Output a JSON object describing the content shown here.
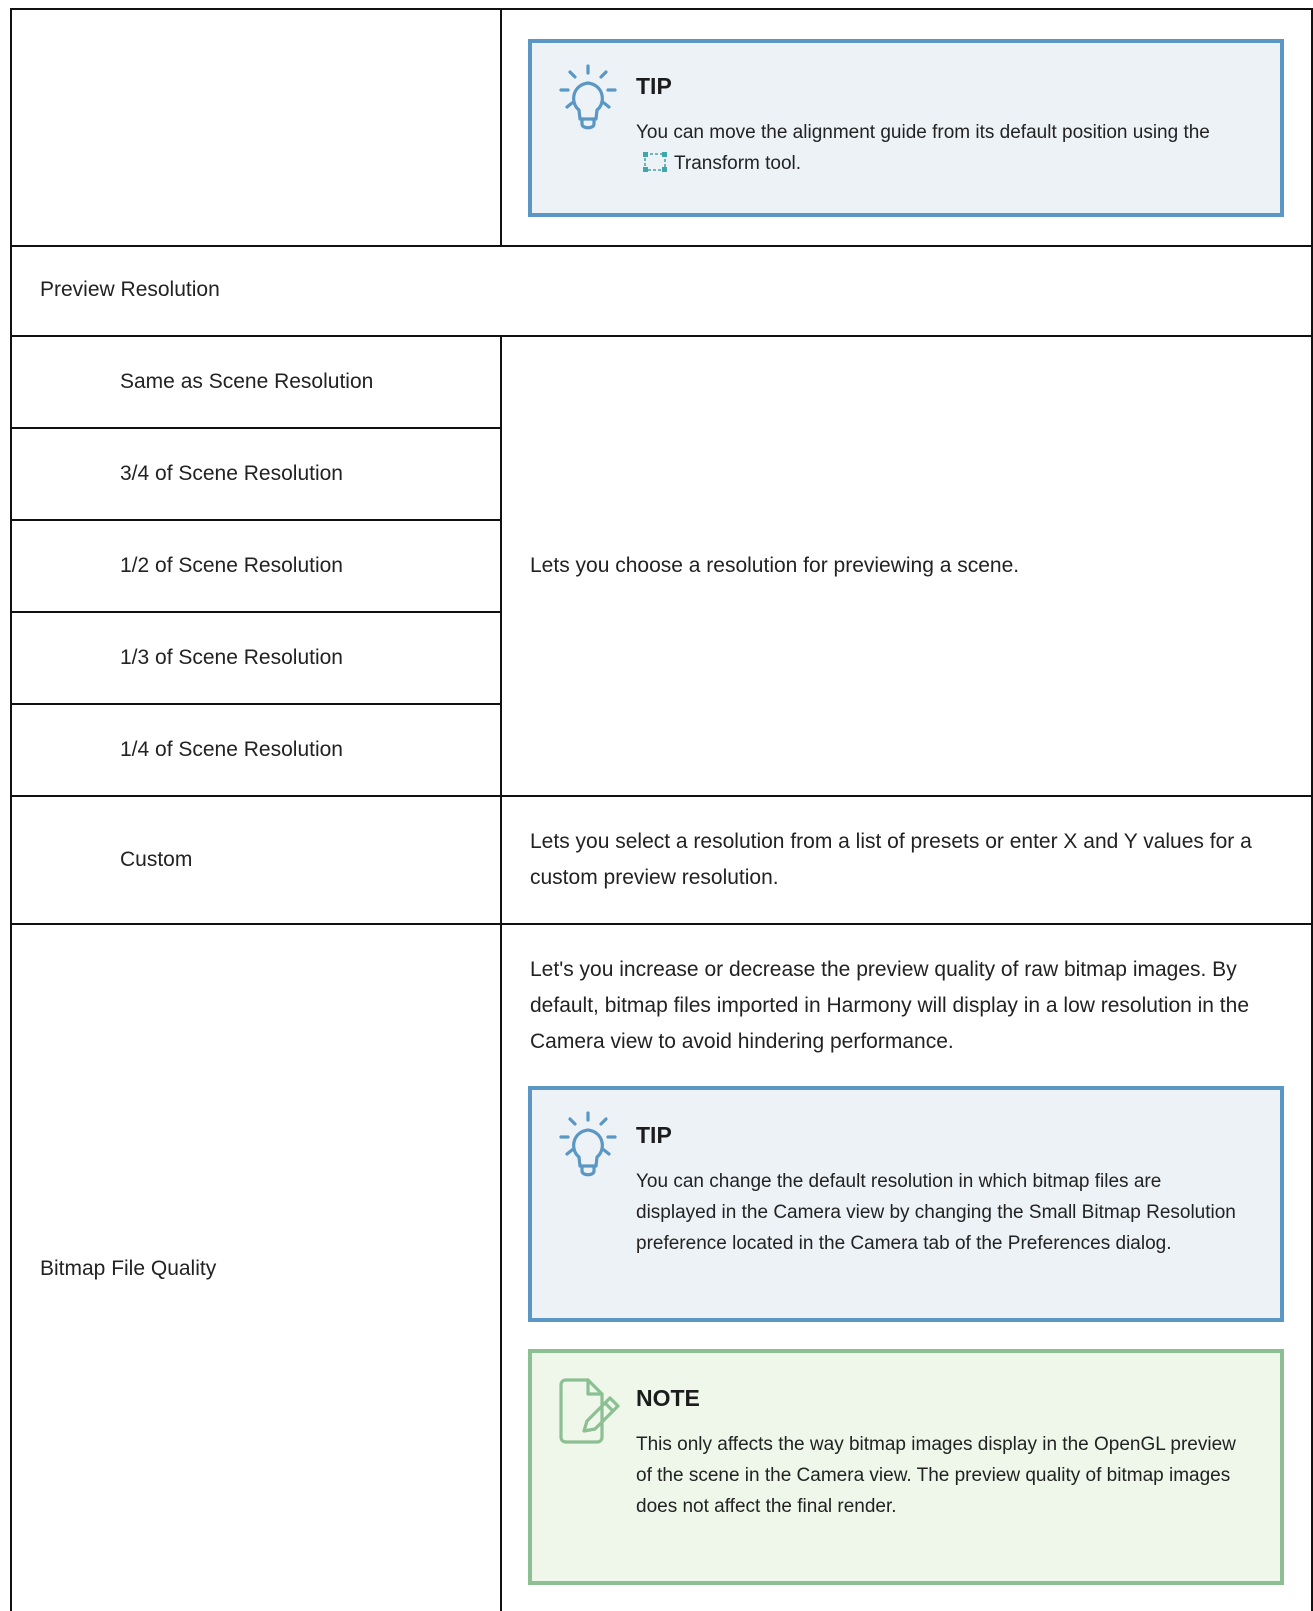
{
  "colors": {
    "tip_border": "#5b97c4",
    "tip_background": "#edf2f7",
    "note_border": "#8cbf92",
    "note_background": "#eef7ea",
    "table_border": "#111111"
  },
  "top_row": {
    "tip": {
      "title": "TIP",
      "text_before_icon": "You can move the alignment guide from its default position using the",
      "tool_icon": "transform-tool-icon",
      "text_after_icon": "Transform tool."
    }
  },
  "preview_resolution": {
    "section_label": "Preview Resolution",
    "options": [
      "Same as Scene Resolution",
      "3/4 of Scene Resolution",
      "1/2 of Scene Resolution",
      "1/3 of Scene Resolution",
      "1/4 of Scene Resolution"
    ],
    "options_description": "Lets you choose a resolution for previewing a scene.",
    "custom_label": "Custom",
    "custom_description": "Lets you select a resolution from a list of presets or enter X and Y values for a custom preview resolution."
  },
  "bitmap_file_quality": {
    "label": "Bitmap File Quality",
    "description": "Let's you increase or decrease the preview quality of raw bitmap images. By default, bitmap files imported in Harmony will display in a low resolution in the Camera view to avoid hindering performance.",
    "tip": {
      "title": "TIP",
      "text": "You can change the default resolution in which bitmap files are displayed in the Camera view by changing the Small Bitmap Resolution preference located in the Camera tab of the Preferences dialog."
    },
    "note": {
      "title": "NOTE",
      "text": "This only affects the way bitmap images display in the OpenGL preview of the scene in the Camera view. The preview quality of bitmap images does not affect the final render."
    }
  }
}
